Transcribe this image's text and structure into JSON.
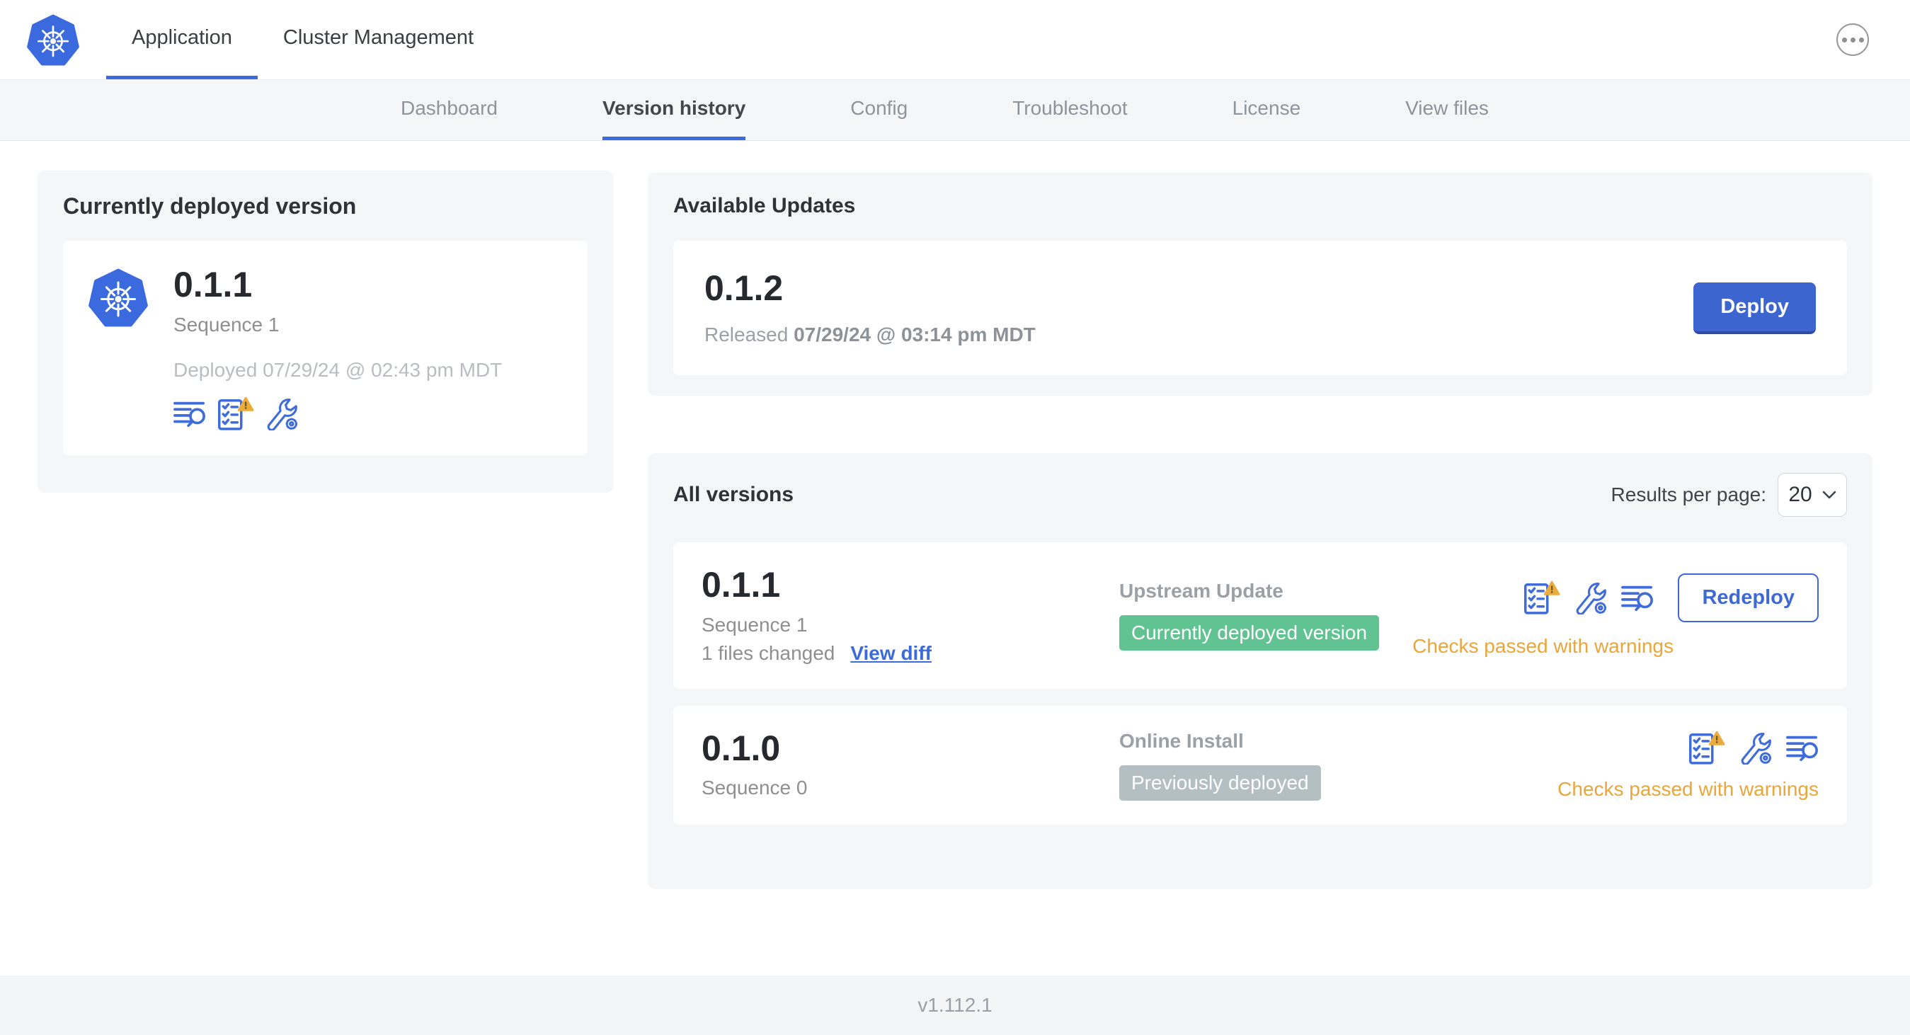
{
  "header": {
    "tabs": [
      {
        "label": "Application",
        "active": true
      },
      {
        "label": "Cluster Management",
        "active": false
      }
    ],
    "menu_icon": "ellipsis-icon",
    "logo_icon": "kubernetes-logo"
  },
  "subnav": {
    "tabs": [
      {
        "label": "Dashboard",
        "active": false
      },
      {
        "label": "Version history",
        "active": true
      },
      {
        "label": "Config",
        "active": false
      },
      {
        "label": "Troubleshoot",
        "active": false
      },
      {
        "label": "License",
        "active": false
      },
      {
        "label": "View files",
        "active": false
      }
    ]
  },
  "currently_deployed": {
    "title": "Currently deployed version",
    "version": "0.1.1",
    "sequence": "Sequence 1",
    "deployed": "Deployed 07/29/24 @ 02:43 pm MDT",
    "icons": [
      "deploy-logs-icon",
      "preflight-checks-warning-icon",
      "config-icon"
    ]
  },
  "available_updates": {
    "title": "Available Updates",
    "version": "0.1.2",
    "released_prefix": "Released",
    "released_date": "07/29/24 @ 03:14 pm MDT",
    "deploy_label": "Deploy"
  },
  "all_versions": {
    "title": "All versions",
    "results_per_page_label": "Results per page:",
    "results_per_page_value": "20",
    "rows": [
      {
        "version": "0.1.1",
        "sequence": "Sequence 1",
        "files_changed": "1 files changed",
        "view_diff_label": "View diff",
        "source": "Upstream Update",
        "badge": "Currently deployed version",
        "badge_color": "#62c392",
        "icons": [
          "preflight-checks-warning-icon",
          "config-icon",
          "deploy-logs-icon"
        ],
        "status": "Checks passed with warnings",
        "action_label": "Redeploy"
      },
      {
        "version": "0.1.0",
        "sequence": "Sequence 0",
        "source": "Online Install",
        "badge": "Previously deployed",
        "badge_color": "#b4bfc3",
        "icons": [
          "preflight-checks-warning-icon",
          "config-icon",
          "deploy-logs-icon"
        ],
        "status": "Checks passed with warnings"
      }
    ]
  },
  "footer": {
    "version": "v1.112.1"
  },
  "colors": {
    "accent_blue": "#3b6cde",
    "button_blue": "#3d65cf",
    "warning_orange": "#e9a63b",
    "badge_green": "#62c392",
    "badge_gray": "#b4bfc3",
    "panel_gray": "#f5f6f8"
  }
}
